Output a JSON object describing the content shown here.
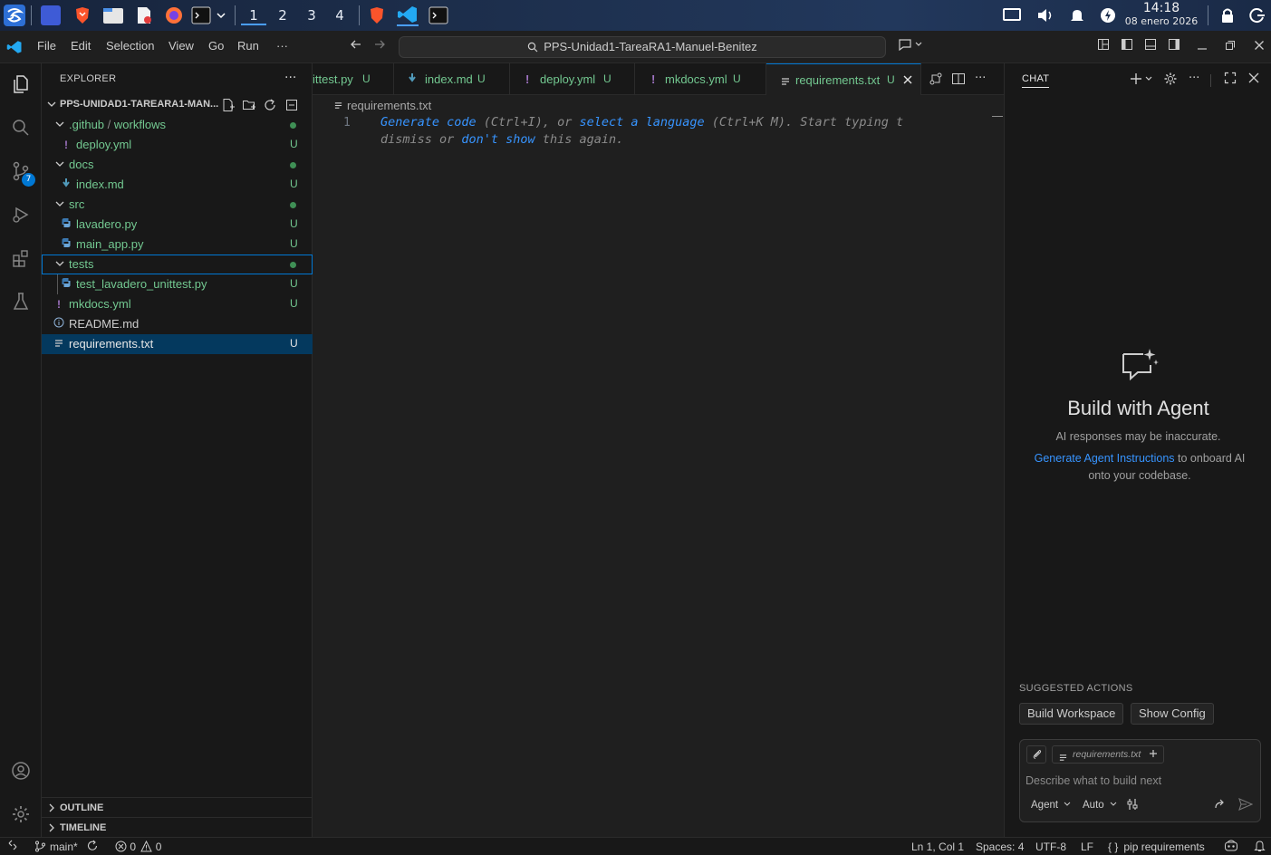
{
  "taskbar": {
    "workspaces": [
      "1",
      "2",
      "3",
      "4"
    ],
    "clock_time": "14:18",
    "clock_date": "08 enero 2026"
  },
  "titlebar": {
    "menu": [
      "File",
      "Edit",
      "Selection",
      "View",
      "Go",
      "Run",
      "···"
    ],
    "command_center": "PPS-Unidad1-TareaRA1-Manuel-Benitez"
  },
  "activitybar": {
    "scm_badge": "7"
  },
  "sidebar": {
    "title": "EXPLORER",
    "more": "···",
    "folder": "PPS-UNIDAD1-TAREARA1-MAN...",
    "tree": [
      {
        "label": ".github",
        "sep": " / ",
        "label2": "workflows",
        "kind": "folder",
        "status": "dot"
      },
      {
        "label": "deploy.yml",
        "kind": "yaml",
        "status": "U"
      },
      {
        "label": "docs",
        "kind": "folder",
        "status": "dot"
      },
      {
        "label": "index.md",
        "kind": "md",
        "status": "U"
      },
      {
        "label": "src",
        "kind": "folder",
        "status": "dot"
      },
      {
        "label": "lavadero.py",
        "kind": "py",
        "status": "U"
      },
      {
        "label": "main_app.py",
        "kind": "py",
        "status": "U"
      },
      {
        "label": "tests",
        "kind": "folder",
        "status": "dot"
      },
      {
        "label": "test_lavadero_unittest.py",
        "kind": "py",
        "status": "U"
      },
      {
        "label": "mkdocs.yml",
        "kind": "yaml",
        "status": "U"
      },
      {
        "label": "README.md",
        "kind": "info",
        "status": ""
      },
      {
        "label": "requirements.txt",
        "kind": "txt",
        "status": "U"
      }
    ],
    "outline": "OUTLINE",
    "timeline": "TIMELINE"
  },
  "editor": {
    "tabs": [
      {
        "label": "ittest.py",
        "status": "U"
      },
      {
        "label": "index.md",
        "status": "U"
      },
      {
        "label": "deploy.yml",
        "status": "U"
      },
      {
        "label": "mkdocs.yml",
        "status": "U"
      },
      {
        "label": "requirements.txt",
        "status": "U"
      }
    ],
    "breadcrumb": "requirements.txt",
    "line_number": "1",
    "hint": {
      "l1a": "Generate code",
      "l1b": " (Ctrl+I), or ",
      "l1c": "select a language",
      "l1d": " (Ctrl+K M). Start typing t",
      "l2a": "dismiss or ",
      "l2b": "don't show",
      "l2c": " this again."
    }
  },
  "chat": {
    "title": "CHAT",
    "heading": "Build with Agent",
    "subheading": "AI responses may be inaccurate.",
    "hint_link": "Generate Agent Instructions",
    "hint_rest": " to onboard AI onto your codebase.",
    "suggested_title": "SUGGESTED ACTIONS",
    "suggestions": [
      "Build Workspace",
      "Show Config"
    ],
    "context_chip": "requirements.txt",
    "placeholder": "Describe what to build next",
    "mode": "Agent",
    "model": "Auto"
  },
  "statusbar": {
    "branch": "main*",
    "errors": "0",
    "warnings": "0",
    "position": "Ln 1, Col 1",
    "spaces": "Spaces: 4",
    "encoding": "UTF-8",
    "eol": "LF",
    "language": "pip requirements"
  },
  "colors": {
    "accent": "#0078d4",
    "git_untracked": "#73c991",
    "link": "#3794ff"
  }
}
